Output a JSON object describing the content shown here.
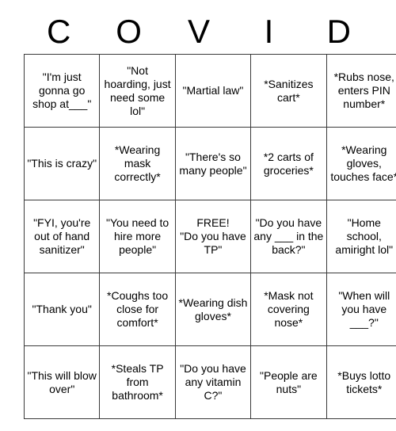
{
  "card": {
    "header_letters": [
      "C",
      "O",
      "V",
      "I",
      "D"
    ],
    "rows": [
      [
        {
          "text": "\"I'm just gonna go shop at___\"",
          "size": "sm"
        },
        {
          "text": "\"Not hoarding, just need some lol\"",
          "size": "sm"
        },
        {
          "text": "\"Martial law\"",
          "size": "xl"
        },
        {
          "text": "*Sanitizes cart*",
          "size": "sm"
        },
        {
          "text": "*Rubs nose, enters PIN number*",
          "size": "sm"
        }
      ],
      [
        {
          "text": "\"This is crazy\"",
          "size": "xl"
        },
        {
          "text": "*Wearing mask correctly*",
          "size": "md"
        },
        {
          "text": "\"There's so many people\"",
          "size": "lg"
        },
        {
          "text": "*2 carts of groceries*",
          "size": "md"
        },
        {
          "text": "*Wearing gloves, touches face*",
          "size": "sm"
        }
      ],
      [
        {
          "text": "\"FYI, you're out of hand sanitizer\"",
          "size": "sm"
        },
        {
          "text": "\"You need to hire more people\"",
          "size": "sm"
        },
        {
          "text": "FREE!\n\"Do you have TP\"",
          "size": "lg"
        },
        {
          "text": "\"Do you have any ___ in the back?\"",
          "size": "sm"
        },
        {
          "text": "\"Home school, amiright lol\"",
          "size": "sm"
        }
      ],
      [
        {
          "text": "\"Thank you\"",
          "size": "xl"
        },
        {
          "text": "*Coughs too close for comfort*",
          "size": "xs"
        },
        {
          "text": "*Wearing dish gloves*",
          "size": "md"
        },
        {
          "text": "*Mask not covering nose*",
          "size": "md"
        },
        {
          "text": "\"When will you have ___?\"",
          "size": "md"
        }
      ],
      [
        {
          "text": "\"This will blow over\"",
          "size": "lg"
        },
        {
          "text": "*Steals TP from bathroom*",
          "size": "sm"
        },
        {
          "text": "\"Do you have any vitamin C?\"",
          "size": "sm"
        },
        {
          "text": "\"People are nuts\"",
          "size": "xl"
        },
        {
          "text": "*Buys lotto tickets*",
          "size": "xl"
        }
      ]
    ]
  }
}
